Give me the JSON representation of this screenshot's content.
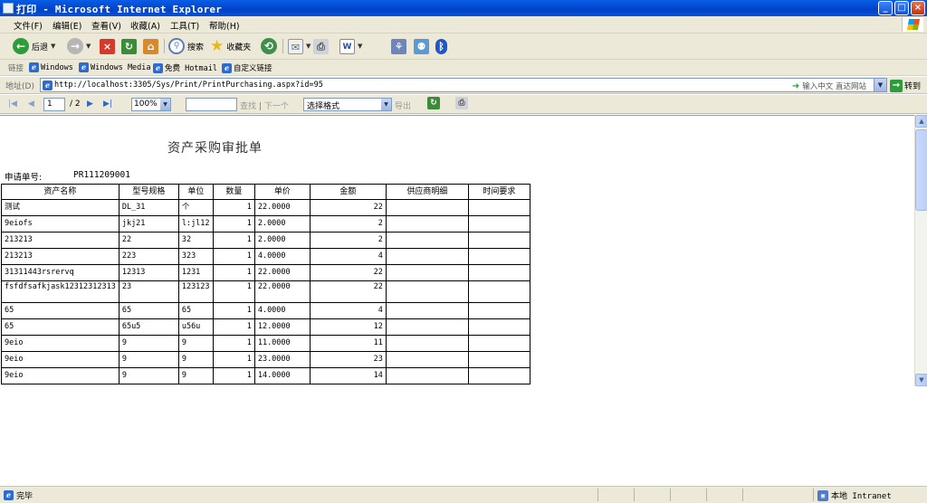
{
  "window": {
    "title": "打印 - Microsoft Internet Explorer",
    "controls": {
      "minimize": "_",
      "maximize": "□",
      "close": "×"
    }
  },
  "menu": [
    "文件(F)",
    "编辑(E)",
    "查看(V)",
    "收藏(A)",
    "工具(T)",
    "帮助(H)"
  ],
  "toolbar": {
    "back": "后退",
    "search": "搜索",
    "favorites": "收藏夹"
  },
  "links": {
    "label": "链接",
    "items": [
      "Windows",
      "Windows Media",
      "免费 Hotmail",
      "自定义链接"
    ]
  },
  "address": {
    "label": "地址(D)",
    "url": "http://localhost:3305/Sys/Print/PrintPurchasing.aspx?id=95",
    "hint": "输入中文 直达网站",
    "go": "转到"
  },
  "report_toolbar": {
    "page": "1",
    "total_pages": "/ 2",
    "zoom": "100%",
    "find": "查找",
    "find_sep": "|",
    "find_next": "下一个",
    "format": "选择格式",
    "export": "导出"
  },
  "report": {
    "title": "资产采购审批单",
    "order_label": "申请单号:",
    "order_number": "PR111209001",
    "columns": [
      "资产名称",
      "型号规格",
      "单位",
      "数量",
      "单价",
      "金额",
      "供应商明细",
      "时间要求"
    ],
    "rows": [
      [
        "测试",
        "DL_31",
        "个",
        "1",
        "22.0000",
        "22",
        "",
        ""
      ],
      [
        "9eiofs",
        "jkj21",
        "l:jl12",
        "1",
        "2.0000",
        "2",
        "",
        ""
      ],
      [
        "213213",
        "22",
        "32",
        "1",
        "2.0000",
        "2",
        "",
        ""
      ],
      [
        "213213",
        "223",
        "323",
        "1",
        "4.0000",
        "4",
        "",
        ""
      ],
      [
        "31311443rsrervq",
        "12313",
        "1231",
        "1",
        "22.0000",
        "22",
        "",
        ""
      ],
      [
        "fsfdfsafkjask12312312313",
        "23",
        "123123",
        "1",
        "22.0000",
        "22",
        "",
        ""
      ],
      [
        "65",
        "65",
        "65",
        "1",
        "4.0000",
        "4",
        "",
        ""
      ],
      [
        "65",
        "65u5",
        "u56u",
        "1",
        "12.0000",
        "12",
        "",
        ""
      ],
      [
        "9eio",
        "9",
        "9",
        "1",
        "11.0000",
        "11",
        "",
        ""
      ],
      [
        "9eio",
        "9",
        "9",
        "1",
        "23.0000",
        "23",
        "",
        ""
      ],
      [
        "9eio",
        "9",
        "9",
        "1",
        "14.0000",
        "14",
        "",
        ""
      ]
    ]
  },
  "status": {
    "left": "完毕",
    "right": "本地 Intranet"
  },
  "icons": {
    "back": "back-arrow-icon",
    "forward": "forward-arrow-icon",
    "stop": "stop-icon",
    "refresh": "refresh-icon",
    "home": "home-icon",
    "search": "magnifier-icon",
    "favorites": "star-icon",
    "history": "history-icon",
    "mail": "mail-icon",
    "print": "printer-icon",
    "edit": "word-icon",
    "messenger": "messenger-icon",
    "bluetooth": "bluetooth-icon"
  },
  "colors": {
    "titlebar": "#0a5de6",
    "chrome": "#ece9d8",
    "go_button": "#2f9c3b"
  }
}
